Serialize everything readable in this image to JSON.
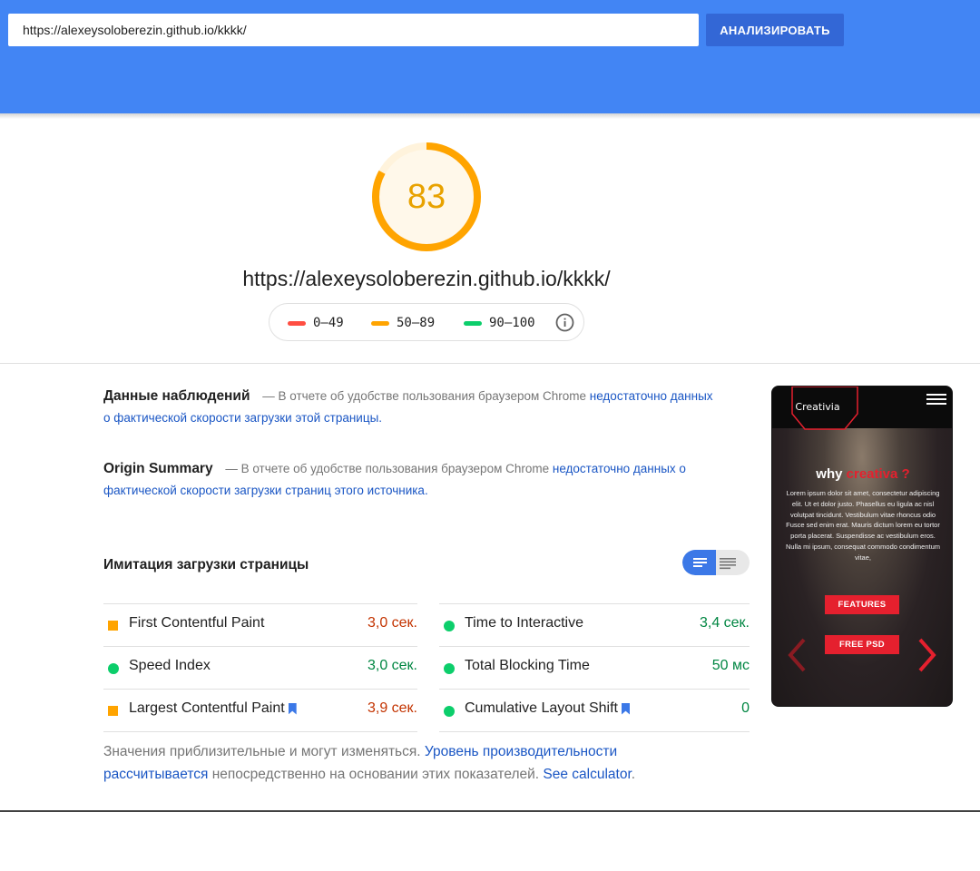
{
  "header": {
    "url_value": "https://alexeysoloberezin.github.io/kkkk/",
    "analyze_label": "АНАЛИЗИРОВАТЬ"
  },
  "score": {
    "value": "83",
    "fraction": 0.83,
    "color": "#ffa400",
    "url": "https://alexeysoloberezin.github.io/kkkk/"
  },
  "legend": {
    "items": [
      {
        "label": "0–49",
        "color": "#ff4e42"
      },
      {
        "label": "50–89",
        "color": "#ffa400"
      },
      {
        "label": "90–100",
        "color": "#0cce6b"
      }
    ],
    "info_icon": "info-icon"
  },
  "field_data": {
    "title": "Данные наблюдений",
    "text": " — В отчете об удобстве пользования браузером Chrome ",
    "link": "недостаточно данных о фактической скорости загрузки этой страницы."
  },
  "origin_summary": {
    "title": "Origin Summary",
    "text": " — В отчете об удобстве пользования браузером Chrome ",
    "link": "недостаточно данных о фактической скорости загрузки страниц этого источника."
  },
  "lab": {
    "title": "Имитация загрузки страницы",
    "toggle_icons": [
      "list-view-icon",
      "detail-view-icon"
    ],
    "metrics_left": [
      {
        "name": "First Contentful Paint",
        "value": "3,0 сек.",
        "status": "average",
        "bookmark": false
      },
      {
        "name": "Speed Index",
        "value": "3,0 сек.",
        "status": "good",
        "bookmark": false
      },
      {
        "name": "Largest Contentful Paint",
        "value": "3,9 сек.",
        "status": "average",
        "bookmark": true
      }
    ],
    "metrics_right": [
      {
        "name": "Time to Interactive",
        "value": "3,4 сек.",
        "status": "good",
        "bookmark": false
      },
      {
        "name": "Total Blocking Time",
        "value": "50 мс",
        "status": "good",
        "bookmark": false
      },
      {
        "name": "Cumulative Layout Shift",
        "value": "0",
        "status": "good",
        "bookmark": true
      }
    ]
  },
  "footnote": {
    "text1": "Значения приблизительные и могут изменяться. ",
    "link1": "Уровень производительности рассчитывается",
    "text2": " непосредственно на основании этих показателей. ",
    "link2": "See calculator",
    "text3": "."
  },
  "thumbnail": {
    "logo": "Creativia",
    "heading_plain": "why ",
    "heading_accent": "creativa ?",
    "body": "Lorem ipsum dolor sit amet, consectetur adipiscing elit. Ut et dolor justo. Phasellus eu ligula ac nisl volutpat tincidunt. Vestibulum vitae rhoncus odio Fusce sed enim erat. Mauris dictum lorem eu tortor porta placerat. Suspendisse ac vestibulum eros. Nulla mi ipsum, consequat commodo condimentum vitae,",
    "button1": "FEATURES",
    "button2": "FREE PSD",
    "accent_color": "#e5202e"
  }
}
